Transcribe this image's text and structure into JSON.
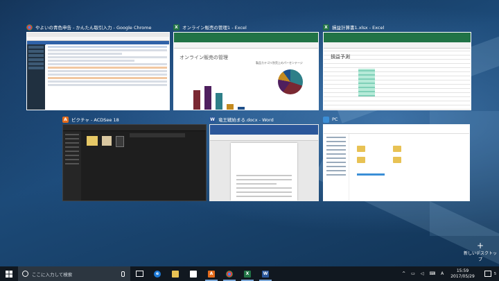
{
  "windows": {
    "chrome": {
      "title": "やよいの青色申告 - かんたん取引入力 - Google Chrome"
    },
    "excel1": {
      "title": "オンライン販売の管理1 - Excel",
      "sheet_title": "オンライン販売の管理",
      "chart_label": "製品カテゴリ別売上のパーセンテージ"
    },
    "excel2": {
      "title": "損益計算書1.xlsx - Excel",
      "sheet_title": "損益予測"
    },
    "acdsee": {
      "title": "ピクチャ - ACDSee 18"
    },
    "word": {
      "title": "竜王戦始まる.docx - Word"
    },
    "explorer": {
      "title": "PC"
    }
  },
  "new_desktop": {
    "label": "新しいデスクトップ"
  },
  "taskbar": {
    "search_placeholder": "ここに入力して検索",
    "time": "15:59",
    "date": "2017/05/29",
    "ime": "A",
    "notifications": "5"
  },
  "colors": {
    "excel_green": "#217346",
    "word_blue": "#2b579a",
    "chrome_red": "#db4437",
    "acdsee_orange": "#e36b1c",
    "taskbar": "#111820"
  },
  "icons": [
    "windows-start-icon",
    "search-icon",
    "microphone-icon",
    "task-view-icon",
    "edge-icon",
    "file-explorer-icon",
    "store-icon",
    "acdsee-icon",
    "chrome-icon",
    "excel-icon",
    "word-icon"
  ]
}
